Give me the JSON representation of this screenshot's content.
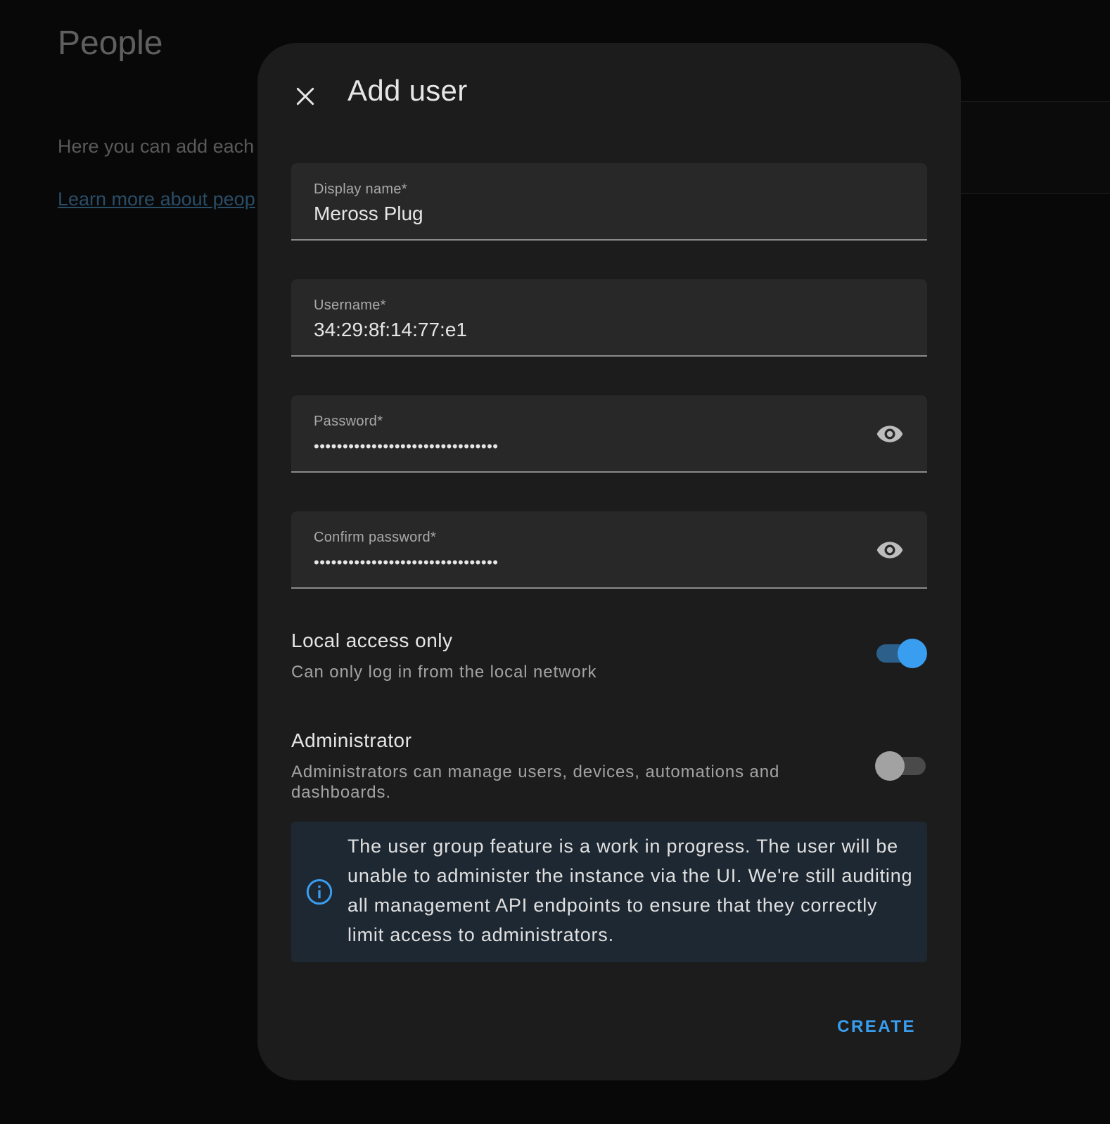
{
  "background": {
    "title": "People",
    "description": "Here you can add each",
    "link_text": "Learn more about peop"
  },
  "dialog": {
    "title": "Add user",
    "fields": {
      "display_name": {
        "label": "Display name*",
        "value": "Meross Plug"
      },
      "username": {
        "label": "Username*",
        "value": "34:29:8f:14:77:e1"
      },
      "password": {
        "label": "Password*",
        "value": "••••••••••••••••••••••••••••••••"
      },
      "confirm_password": {
        "label": "Confirm password*",
        "value": "••••••••••••••••••••••••••••••••"
      }
    },
    "local_access": {
      "title": "Local access only",
      "description": "Can only log in from the local network",
      "enabled": true
    },
    "administrator": {
      "title": "Administrator",
      "description": "Administrators can manage users, devices, automations and dashboards.",
      "enabled": false
    },
    "alert": {
      "text": "The user group feature is a work in progress. The user will be unable to administer the instance via the UI. We're still auditing all management API endpoints to ensure that they correctly limit access to administrators."
    },
    "create_label": "CREATE"
  },
  "colors": {
    "accent": "#3a9ef0",
    "dialog_bg": "#1c1c1c",
    "field_bg": "#282828",
    "alert_bg": "#1e2832"
  },
  "icons": {
    "close": "close-icon",
    "eye": "eye-icon",
    "info": "info-icon"
  }
}
